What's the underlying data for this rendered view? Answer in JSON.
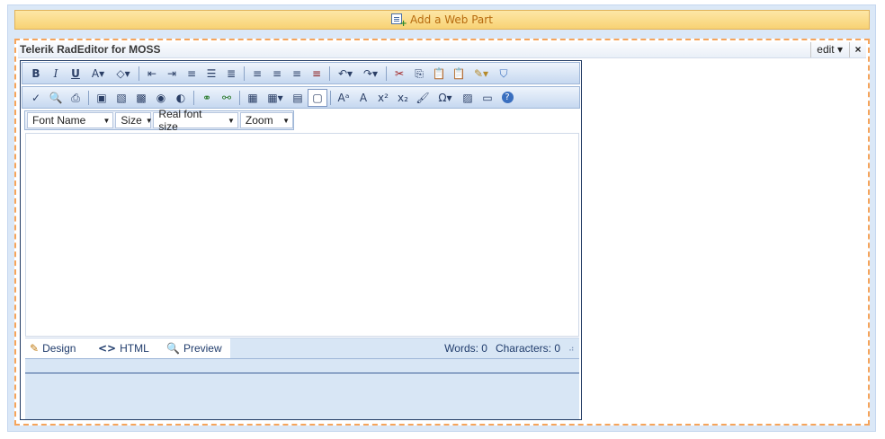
{
  "zone": {
    "add_label": "Add a Web Part"
  },
  "webpart": {
    "title": "Telerik RadEditor for MOSS",
    "edit_label": "edit ▾",
    "close_label": "×"
  },
  "toolbar1": [
    {
      "name": "bold",
      "glyph": "B"
    },
    {
      "name": "italic",
      "glyph": "I"
    },
    {
      "name": "underline",
      "glyph": "U"
    },
    {
      "name": "forecolor",
      "glyph": "A▾"
    },
    {
      "name": "backcolor",
      "glyph": "◇▾"
    },
    {
      "name": "outdent",
      "glyph": "⇤"
    },
    {
      "name": "indent",
      "glyph": "⇥"
    },
    {
      "name": "ordered-list",
      "glyph": "≡"
    },
    {
      "name": "unordered-list",
      "glyph": "☰"
    },
    {
      "name": "paragraph",
      "glyph": "≣"
    },
    {
      "name": "align-left",
      "glyph": "≡"
    },
    {
      "name": "align-center",
      "glyph": "≡"
    },
    {
      "name": "align-right",
      "glyph": "≡"
    },
    {
      "name": "justify",
      "glyph": "≡"
    },
    {
      "name": "undo",
      "glyph": "↶▾"
    },
    {
      "name": "redo",
      "glyph": "↷▾"
    },
    {
      "name": "cut",
      "glyph": "✂"
    },
    {
      "name": "copy",
      "glyph": "⎘"
    },
    {
      "name": "paste",
      "glyph": "📋"
    },
    {
      "name": "paste-special",
      "glyph": "📋"
    },
    {
      "name": "format-stripper",
      "glyph": "✎▾"
    },
    {
      "name": "shield",
      "glyph": "⛉"
    }
  ],
  "toolbar2": [
    {
      "name": "spellcheck",
      "glyph": "✓"
    },
    {
      "name": "find-replace",
      "glyph": "🔍"
    },
    {
      "name": "print",
      "glyph": "⎙"
    },
    {
      "name": "image-manager",
      "glyph": "▣"
    },
    {
      "name": "image-map",
      "glyph": "▧"
    },
    {
      "name": "image",
      "glyph": "▩"
    },
    {
      "name": "media",
      "glyph": "◉"
    },
    {
      "name": "flash",
      "glyph": "◐"
    },
    {
      "name": "link",
      "glyph": "⚭"
    },
    {
      "name": "unlink",
      "glyph": "⚯"
    },
    {
      "name": "table",
      "glyph": "▦"
    },
    {
      "name": "table-menu",
      "glyph": "▦▾"
    },
    {
      "name": "form",
      "glyph": "▤"
    },
    {
      "name": "toggle-border",
      "glyph": "▢"
    },
    {
      "name": "format",
      "glyph": "Aᵃ"
    },
    {
      "name": "font-size-change",
      "glyph": "A"
    },
    {
      "name": "superscript",
      "glyph": "x²"
    },
    {
      "name": "subscript",
      "glyph": "x₂"
    },
    {
      "name": "format-painter",
      "glyph": "🖌"
    },
    {
      "name": "symbols",
      "glyph": "Ω▾"
    },
    {
      "name": "special",
      "glyph": "▨"
    },
    {
      "name": "module",
      "glyph": "▭"
    },
    {
      "name": "help",
      "glyph": "?"
    }
  ],
  "dropdowns": [
    {
      "name": "font-name",
      "label": "Font Name"
    },
    {
      "name": "size",
      "label": "Size"
    },
    {
      "name": "real-font-size",
      "label": "Real font size"
    },
    {
      "name": "zoom",
      "label": "Zoom"
    }
  ],
  "modes": {
    "design": "Design",
    "html": "HTML",
    "preview": "Preview"
  },
  "status": {
    "words": "Words: 0",
    "characters": "Characters: 0"
  },
  "colors": {
    "accent_orange": "#f6a45a",
    "toolbar_blue": "#c6d8f0",
    "add_bar_text": "#b76b0f"
  }
}
